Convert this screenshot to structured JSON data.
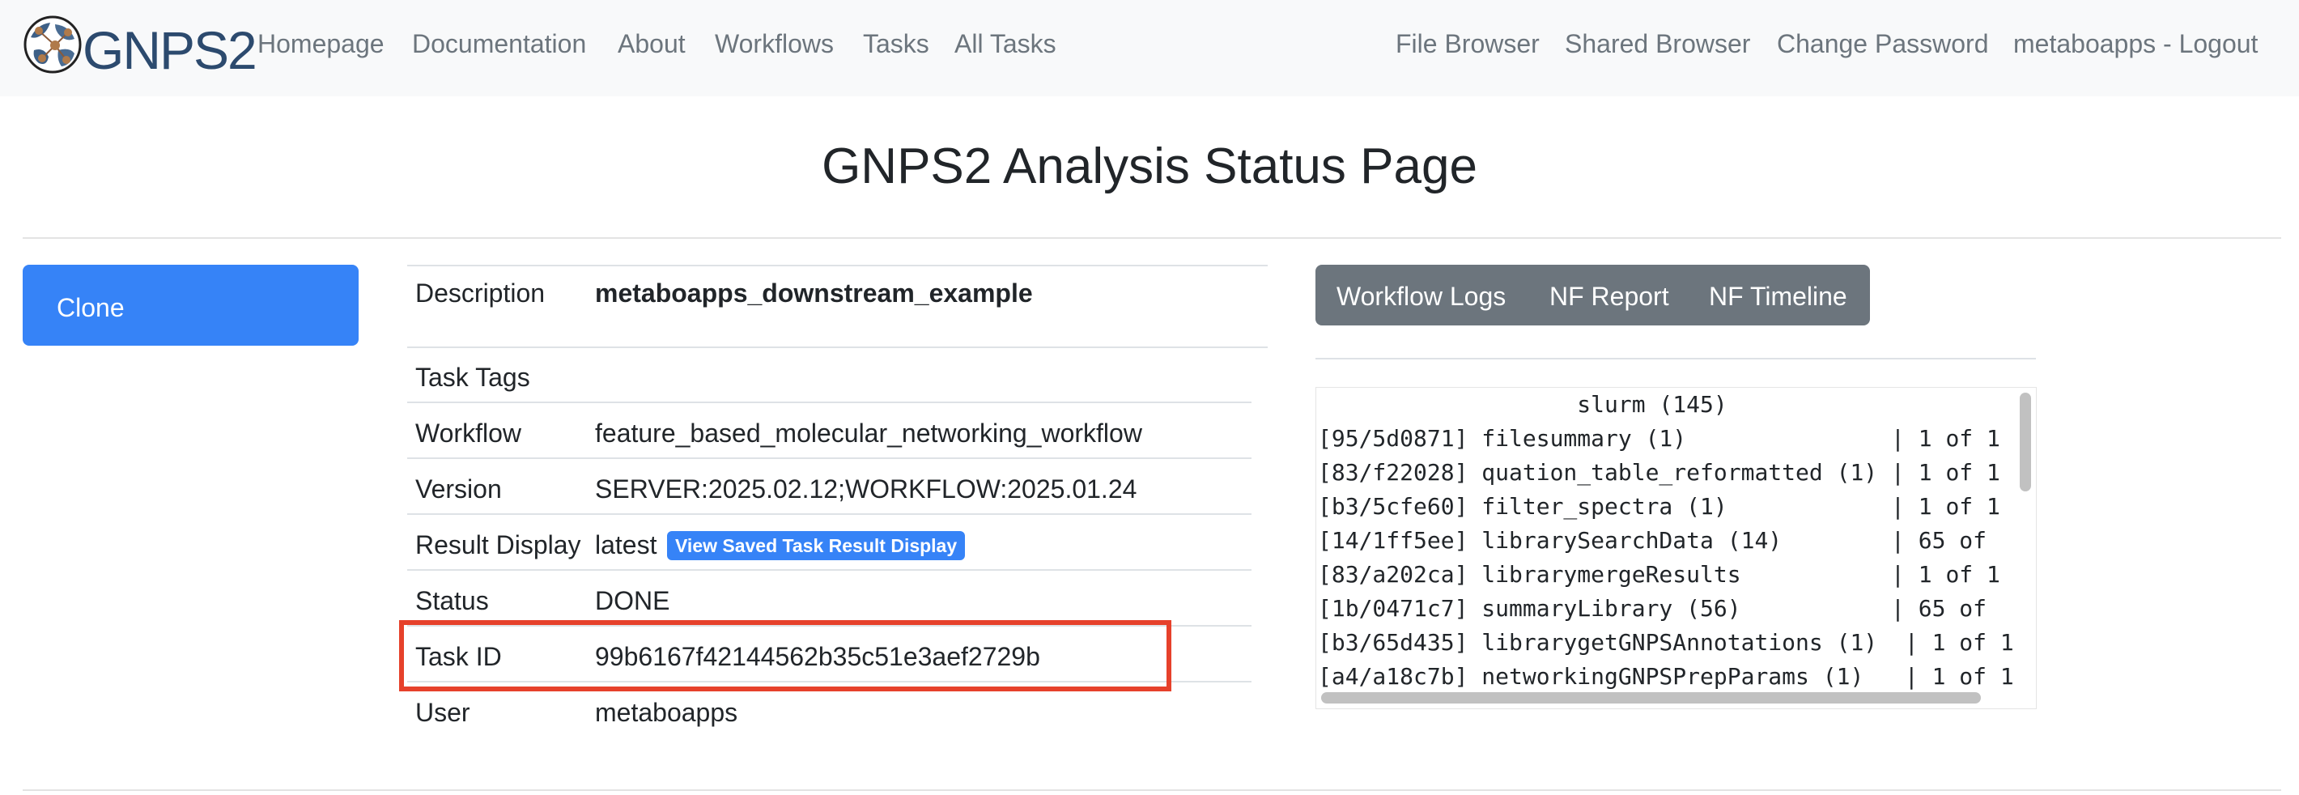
{
  "brand": {
    "logo_text": "GNPS2"
  },
  "nav": {
    "left": [
      "Homepage",
      "Documentation",
      "About",
      "Workflows",
      "Tasks",
      "All Tasks"
    ],
    "right": [
      "File Browser",
      "Shared Browser",
      "Change Password",
      "metaboapps - Logout"
    ]
  },
  "page": {
    "title": "GNPS2 Analysis Status Page"
  },
  "actions": {
    "clone_label": "Clone"
  },
  "task": {
    "description_label": "Description",
    "description_value": "metaboapps_downstream_example",
    "tags_label": "Task Tags",
    "tags_value": "",
    "workflow_label": "Workflow",
    "workflow_value": "feature_based_molecular_networking_workflow",
    "version_label": "Version",
    "version_value": "SERVER:2025.02.12;WORKFLOW:2025.01.24",
    "result_display_label": "Result Display",
    "result_display_value": "latest",
    "saved_display_button": "View Saved Task Result Display",
    "status_label": "Status",
    "status_value": "DONE",
    "task_id_label": "Task ID",
    "task_id_value": "99b6167f42144562b35c51e3aef2729b",
    "user_label": "User",
    "user_value": "metaboapps"
  },
  "log_tabs": [
    "Workflow Logs",
    "NF Report",
    "NF Timeline"
  ],
  "log_lines": [
    "                   slurm (145)",
    "[95/5d0871] filesummary (1)               | 1 of 1",
    "[83/f22028] quation_table_reformatted (1) | 1 of 1",
    "[b3/5cfe60] filter_spectra (1)            | 1 of 1",
    "[14/1ff5ee] librarySearchData (14)        | 65 of",
    "[83/a202ca] librarymergeResults           | 1 of 1",
    "[1b/0471c7] summaryLibrary (56)           | 65 of",
    "[b3/65d435] librarygetGNPSAnnotations (1)  | 1 of 1",
    "[a4/a18c7b] networkingGNPSPrepParams (1)   | 1 of 1"
  ],
  "colors": {
    "primary": "#3683f7",
    "secondary": "#6c757d",
    "highlight": "#e6412b",
    "navbar_bg": "#f8f9fa"
  }
}
